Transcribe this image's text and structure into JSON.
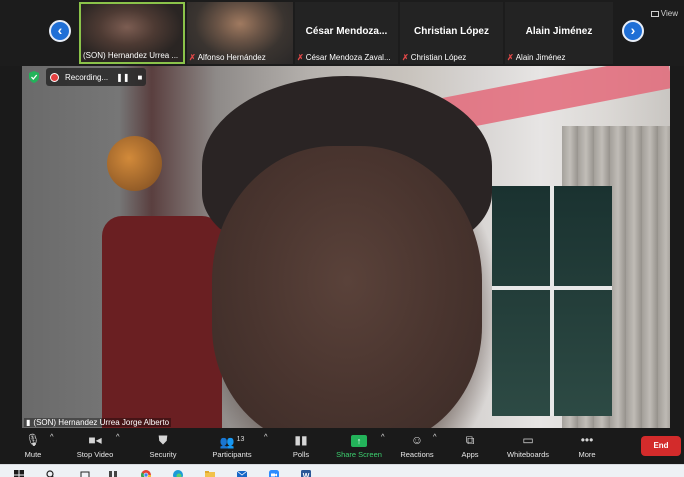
{
  "strip": {
    "tiles": [
      {
        "name": "",
        "label": "(SON) Hernandez Urrea ...",
        "muted": false,
        "video": true
      },
      {
        "name": "",
        "label": "Alfonso Hernández",
        "muted": true,
        "video": true
      },
      {
        "name": "César Mendoza...",
        "label": "César Mendoza Zaval...",
        "muted": true,
        "video": false
      },
      {
        "name": "Christian López",
        "label": "Christian López",
        "muted": true,
        "video": false
      },
      {
        "name": "Alain Jiménez",
        "label": "Alain Jiménez",
        "muted": true,
        "video": false
      }
    ],
    "view_label": "View"
  },
  "recording": {
    "label": "Recording..."
  },
  "main": {
    "speaker_label": "(SON) Hernandez Urrea Jorge Alberto"
  },
  "toolbar": {
    "mute": "Mute",
    "stop_video": "Stop Video",
    "security": "Security",
    "participants": "Participants",
    "participants_count": "13",
    "polls": "Polls",
    "share_screen": "Share Screen",
    "reactions": "Reactions",
    "apps": "Apps",
    "whiteboards": "Whiteboards",
    "more": "More",
    "end": "End"
  },
  "colors": {
    "share_green": "#23b35a",
    "end_red": "#d32b2b",
    "active_border": "#8bc34a",
    "nav_blue": "#1f6fd6",
    "mute_red": "#e04848"
  }
}
